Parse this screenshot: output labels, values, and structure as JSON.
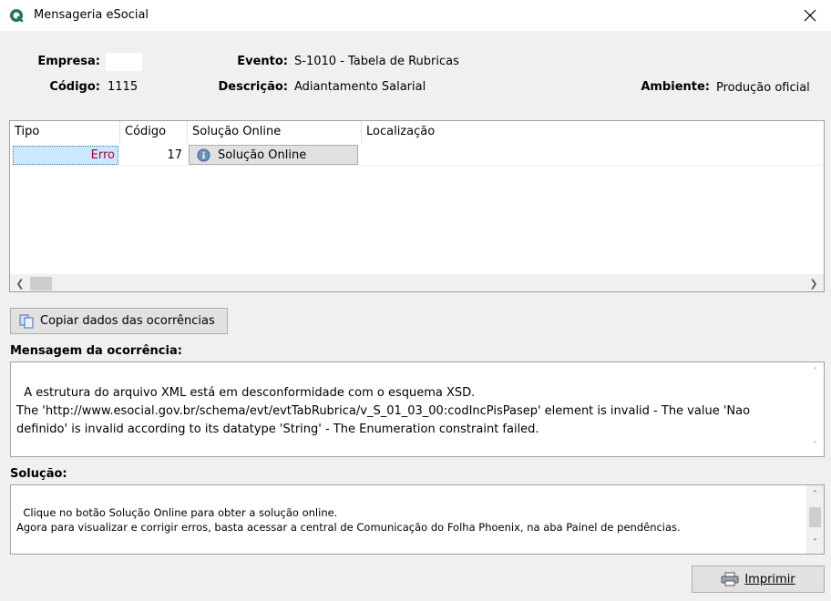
{
  "window": {
    "title": "Mensageria eSocial"
  },
  "header": {
    "empresa_label": "Empresa:",
    "empresa_value": "",
    "codigo_label": "Código:",
    "codigo_value": "1115",
    "evento_label": "Evento:",
    "evento_value": "S-1010 - Tabela de Rubricas",
    "descricao_label": "Descrição:",
    "descricao_value": "Adiantamento Salarial",
    "ambiente_label": "Ambiente:",
    "ambiente_value": "Produção oficial"
  },
  "grid": {
    "columns": [
      "Tipo",
      "Código",
      "Solução Online",
      "Localização"
    ],
    "rows": [
      {
        "tipo": "Erro",
        "codigo": "17",
        "solucao_button": "Solução Online",
        "localizacao": ""
      }
    ]
  },
  "buttons": {
    "copy_label": "Copiar dados das ocorrências",
    "print_label": "Imprimir"
  },
  "mensagem": {
    "label": "Mensagem da ocorrência:",
    "text": "A estrutura do arquivo XML está em desconformidade com o esquema XSD.\nThe 'http://www.esocial.gov.br/schema/evt/evtTabRubrica/v_S_01_03_00:codIncPisPasep' element is invalid - The value 'Nao definido' is invalid according to its datatype 'String' - The Enumeration constraint failed."
  },
  "solucao": {
    "label": "Solução:",
    "text": "Clique no botão Solução Online para obter a solução online.\nAgora para visualizar e corrigir erros, basta acessar a central de Comunicação do Folha Phoenix, na aba Painel de pendências."
  },
  "colors": {
    "accent_selected": "#cce8ff",
    "error_text": "#b0003a",
    "button_face": "#e1e1e1"
  }
}
